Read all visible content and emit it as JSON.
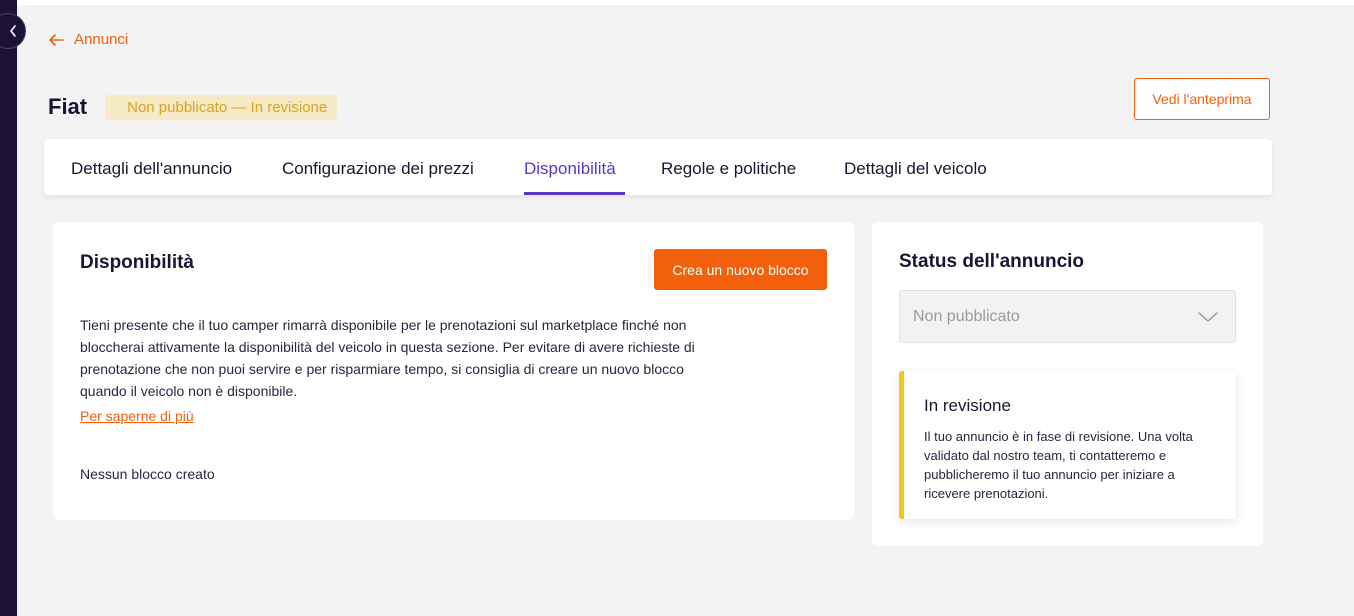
{
  "nav": {
    "back_label": "Annunci"
  },
  "listing": {
    "title": "Fiat",
    "status_badge": "Non pubblicato — In revisione",
    "preview_label": "Vedi l'anteprima"
  },
  "tabs": [
    {
      "label": "Dettagli dell'annuncio",
      "active": false
    },
    {
      "label": "Configurazione dei prezzi",
      "active": false
    },
    {
      "label": "Disponibilità",
      "active": true
    },
    {
      "label": "Regole e politiche",
      "active": false
    },
    {
      "label": "Dettagli del veicolo",
      "active": false
    }
  ],
  "availability": {
    "title": "Disponibilità",
    "create_button": "Crea un nuovo blocco",
    "description": "Tieni presente che il tuo camper rimarrà disponibile per le prenotazioni sul marketplace finché non bloccherai attivamente la disponibilità del veicolo in questa sezione. Per evitare di avere richieste di prenotazione che non puoi servire e per risparmiare tempo, si consiglia di creare un nuovo blocco quando il veicolo non è disponibile.",
    "learn_more": "Per saperne di più",
    "empty_state": "Nessun blocco creato"
  },
  "status_panel": {
    "title": "Status dell'annuncio",
    "select_value": "Non pubblicato",
    "review_title": "In revisione",
    "review_text": "Il tuo annuncio è in fase di revisione. Una volta validato dal nostro team, ti contatteremo e pubblicheremo il tuo annuncio per iniziare a ricevere prenotazioni."
  },
  "colors": {
    "accent": "#f2600c",
    "active_tab": "#5a35c8",
    "sidebar": "#1b1236",
    "badge_bg": "#f6e9c6",
    "badge_text": "#d9a420",
    "review_border": "#f5c518"
  },
  "icons": {
    "collapse": "chevron-left-icon",
    "back": "arrow-left-icon",
    "select": "chevron-down-icon"
  }
}
